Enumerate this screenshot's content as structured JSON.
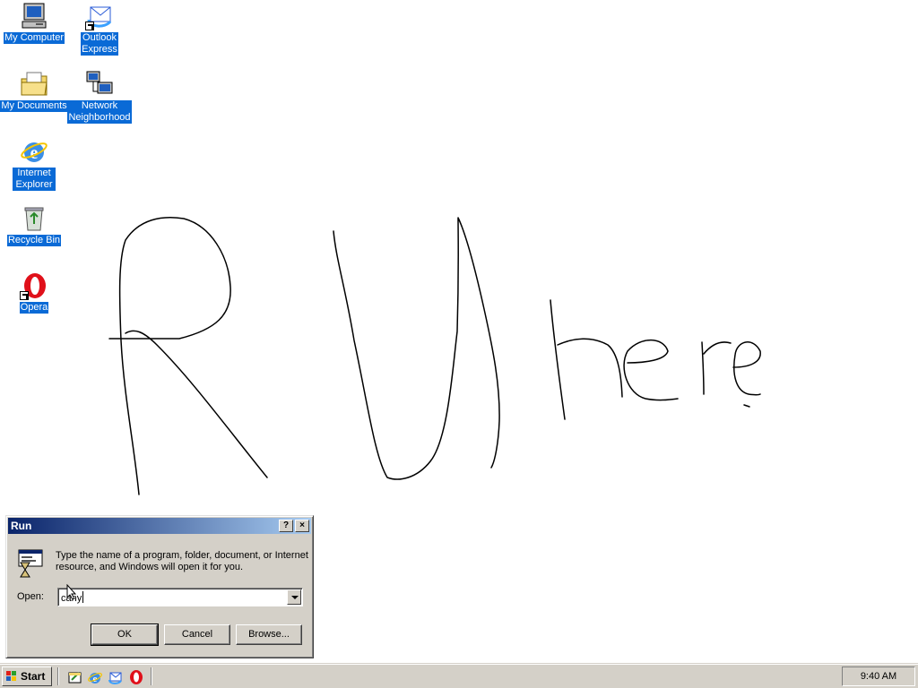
{
  "desktop": {
    "icons": [
      {
        "label": "My Computer"
      },
      {
        "label": "Outlook Express"
      },
      {
        "label": "My Documents"
      },
      {
        "label": "Network Neighborhood"
      },
      {
        "label": "Internet Explorer"
      },
      {
        "label": "Recycle Bin"
      },
      {
        "label": "Opera"
      }
    ],
    "handwriting": "R U here"
  },
  "run_dialog": {
    "title": "Run",
    "help_label": "?",
    "close_label": "×",
    "description": "Type the name of a program, folder, document, or Internet resource, and Windows will open it for you.",
    "open_label": "Open:",
    "open_value": "cany",
    "ok_label": "OK",
    "cancel_label": "Cancel",
    "browse_label": "Browse..."
  },
  "taskbar": {
    "start_label": "Start",
    "clock": "9:40 AM",
    "quick_launch": [
      "show-desktop-icon",
      "internet-explorer-icon",
      "outlook-express-icon",
      "opera-icon"
    ]
  },
  "colors": {
    "selection": "#0a6ad6",
    "titlebar_start": "#0a246a",
    "titlebar_end": "#a6caf0",
    "face": "#d4d0c8"
  }
}
